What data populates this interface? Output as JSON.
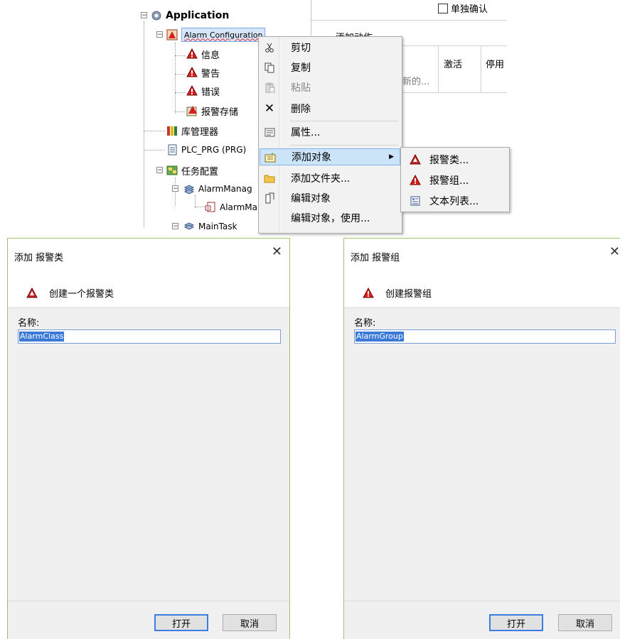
{
  "tree": {
    "app_label": "Application",
    "nodes": [
      "Alarm Configuration",
      "信息",
      "警告",
      "错误",
      "报警存储",
      "库管理器",
      "PLC_PRG (PRG)",
      "任务配置",
      "AlarmManag",
      "AlarmMa",
      "MainTask"
    ]
  },
  "right_panel": {
    "checkbox_label": "单独确认",
    "section_label": "添加动作",
    "col_activate": "激活",
    "col_disable": "停用",
    "cell_new": "新的..."
  },
  "context_menu": {
    "items": [
      {
        "label": "剪切",
        "icon": "scissors-icon",
        "enabled": true
      },
      {
        "label": "复制",
        "icon": "copy-icon",
        "enabled": true
      },
      {
        "label": "粘贴",
        "icon": "paste-icon",
        "enabled": false
      },
      {
        "label": "删除",
        "icon": "delete-x-icon",
        "enabled": true
      },
      {
        "label": "属性...",
        "icon": "properties-icon",
        "enabled": true
      },
      {
        "label": "添加对象",
        "icon": "add-object-icon",
        "enabled": true,
        "highlighted": true
      },
      {
        "label": "添加文件夹...",
        "icon": "folder-icon",
        "enabled": true
      },
      {
        "label": "编辑对象",
        "icon": "edit-object-icon",
        "enabled": true
      },
      {
        "label": "编辑对象，使用...",
        "icon": "",
        "enabled": true
      }
    ],
    "submenu": [
      {
        "label": "报警类...",
        "icon": "alarm-class-icon"
      },
      {
        "label": "报警组...",
        "icon": "alarm-group-icon"
      },
      {
        "label": "文本列表...",
        "icon": "text-list-icon"
      }
    ]
  },
  "dialog_class": {
    "title": "添加 报警类",
    "subtitle": "创建一个报警类",
    "name_label": "名称:",
    "name_value": "AlarmClass",
    "open_label": "打开",
    "cancel_label": "取消"
  },
  "dialog_group": {
    "title": "添加 报警组",
    "subtitle": "创建报警组",
    "name_label": "名称:",
    "name_value": "AlarmGroup",
    "open_label": "打开",
    "cancel_label": "取消"
  },
  "colors": {
    "menu_highlight": "#cce4f7",
    "selection": "#3b79d8",
    "dialog_border": "#9fc46a",
    "alarm_red": "#d62020"
  }
}
